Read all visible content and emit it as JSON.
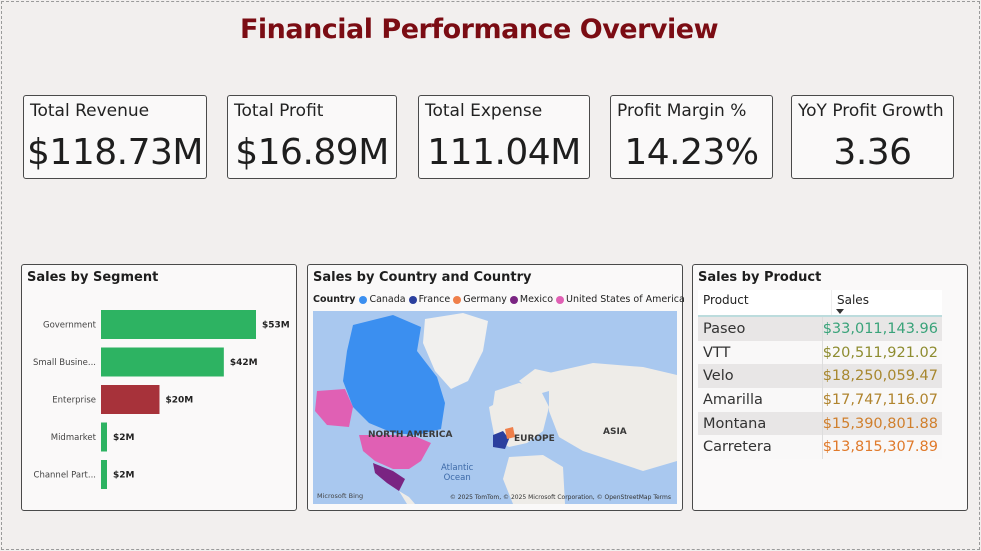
{
  "title": "Financial Performance Overview",
  "kpis": [
    {
      "label": "Total Revenue",
      "value": "$118.73M"
    },
    {
      "label": "Total Profit",
      "value": "$16.89M"
    },
    {
      "label": "Total Expense",
      "value": "111.04M"
    },
    {
      "label": "Profit Margin %",
      "value": "14.23%"
    },
    {
      "label": "YoY Profit Growth",
      "value": "3.36"
    }
  ],
  "segment_chart": {
    "title": "Sales by Segment"
  },
  "map_chart": {
    "title": "Sales by Country and Country",
    "legend_title": "Country",
    "legend": [
      {
        "name": "Canada",
        "color": "#3b8ff0"
      },
      {
        "name": "France",
        "color": "#2b3f9e"
      },
      {
        "name": "Germany",
        "color": "#ef7f4a"
      },
      {
        "name": "Mexico",
        "color": "#7a2482"
      },
      {
        "name": "United States of America",
        "color": "#e060b4"
      }
    ],
    "labels": {
      "north_america": "NORTH AMERICA",
      "europe": "EUROPE",
      "asia": "ASIA",
      "ocean_line1": "Atlantic",
      "ocean_line2": "Ocean"
    },
    "bing": "Microsoft Bing",
    "attribution": "© 2025 TomTom, © 2025 Microsoft Corporation, © OpenStreetMap  Terms"
  },
  "product_table": {
    "title": "Sales by Product",
    "col_product": "Product",
    "col_sales": "Sales",
    "rows": [
      {
        "product": "Paseo",
        "sales": "$33,011,143.96",
        "color": "#3aa37a"
      },
      {
        "product": "VTT",
        "sales": "$20,511,921.02",
        "color": "#8e8c30"
      },
      {
        "product": "Velo",
        "sales": "$18,250,059.47",
        "color": "#a7872e"
      },
      {
        "product": "Amarilla",
        "sales": "$17,747,116.07",
        "color": "#b0842e"
      },
      {
        "product": "Montana",
        "sales": "$15,390,801.88",
        "color": "#d07f2c"
      },
      {
        "product": "Carretera",
        "sales": "$13,815,307.89",
        "color": "#e07a2b"
      }
    ]
  },
  "chart_data": {
    "type": "bar",
    "orientation": "horizontal",
    "title": "Sales by Segment",
    "categories": [
      "Government",
      "Small Busine...",
      "Enterprise",
      "Midmarket",
      "Channel Part..."
    ],
    "values": [
      53,
      42,
      20,
      2,
      2
    ],
    "data_labels": [
      "$53M",
      "$42M",
      "$20M",
      "$2M",
      "$2M"
    ],
    "colors": [
      "#2db362",
      "#2db362",
      "#a7323a",
      "#2db362",
      "#2db362"
    ],
    "unit": "$M",
    "xlim": [
      0,
      53
    ]
  }
}
